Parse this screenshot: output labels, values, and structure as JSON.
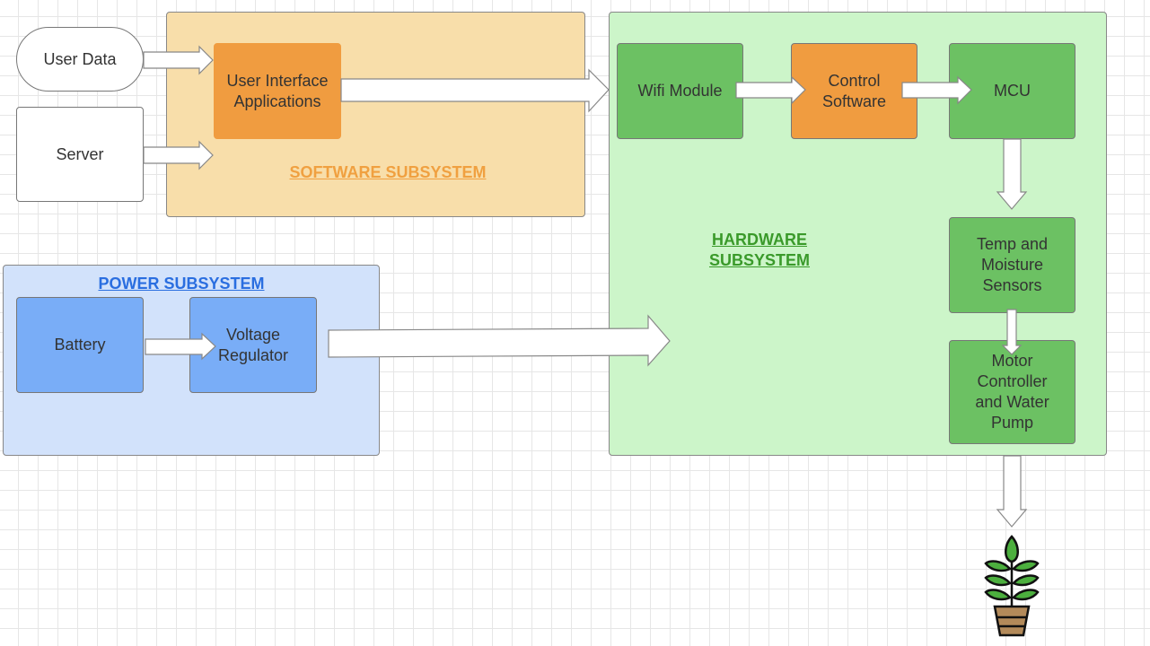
{
  "colors": {
    "software_bg": "#f8deaa",
    "software_block": "#f09c40",
    "software_label": "#f0a040",
    "hardware_bg": "#ccf5c9",
    "hardware_block": "#6cc163",
    "hardware_label": "#3a9a2a",
    "power_bg": "#d2e2fb",
    "power_block": "#79adf7",
    "power_label": "#2a6ee0"
  },
  "external": {
    "user_data": "User Data",
    "server": "Server"
  },
  "software": {
    "label": "SOFTWARE SUBSYSTEM",
    "ui_apps": "User Interface Applications"
  },
  "hardware": {
    "label": "HARDWARE SUBSYSTEM",
    "wifi": "Wifi Module",
    "control": "Control Software",
    "mcu": "MCU",
    "sensors": "Temp and Moisture Sensors",
    "motor": "Motor Controller and Water Pump"
  },
  "power": {
    "label": "POWER SUBSYSTEM",
    "battery": "Battery",
    "regulator": "Voltage Regulator"
  },
  "output": {
    "icon": "potted-plant-icon"
  }
}
